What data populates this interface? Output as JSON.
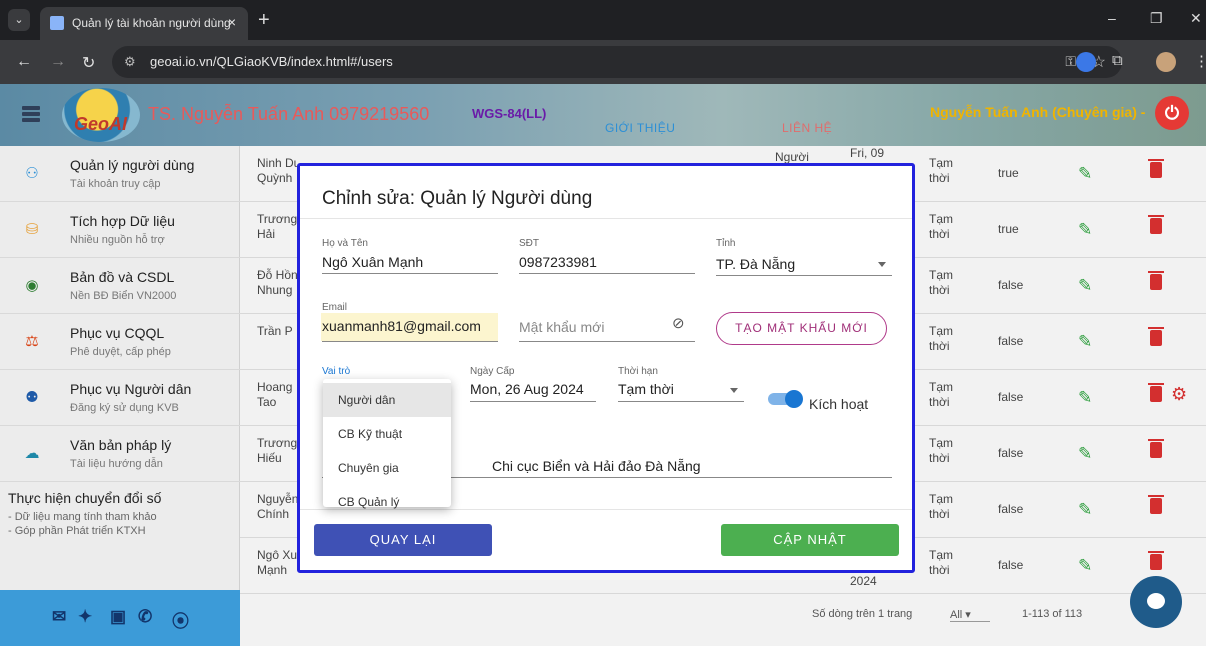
{
  "browser": {
    "tab_title": "Quản lý tài khoản người dùng",
    "tab_close": "×",
    "new_tab": "+",
    "url": "geoai.io.vn/QLGiaoKVB/index.html#/users"
  },
  "header": {
    "logo_text": "GeoAI",
    "brand": "TS. Nguyễn Tuấn Anh 0979219560",
    "crs": "WGS-84(LL)",
    "nav_intro": "GIỚI THIỆU",
    "nav_contact": "LIÊN HỆ",
    "user": "Nguyễn Tuấn Anh (Chuyên gia) -"
  },
  "sidebar": {
    "items": [
      {
        "title": "Quản lý người dùng",
        "sub": "Tài khoản truy cập"
      },
      {
        "title": "Tích hợp Dữ liệu",
        "sub": "Nhiều nguồn hỗ trợ"
      },
      {
        "title": "Bản đồ và CSDL",
        "sub": "Nền BĐ Biển VN2000"
      },
      {
        "title": "Phục vụ CQQL",
        "sub": "Phê duyệt, cấp phép"
      },
      {
        "title": "Phục vụ Người dân",
        "sub": "Đăng ký sử dụng KVB"
      },
      {
        "title": "Văn bản pháp lý",
        "sub": "Tài liệu hướng dẫn"
      }
    ],
    "footer_title": "Thực hiện chuyển đổi số",
    "footer_line1": "- Dữ liệu mang tính tham khảo",
    "footer_line2": "- Góp phần Phát triển KTXH"
  },
  "table": {
    "rows": [
      {
        "name1": "Ninh Duy",
        "name2": "Quỳnh",
        "cat1": "Tạm",
        "cat2": "thời",
        "active": "true"
      },
      {
        "name1": "Trương",
        "name2": "Hải",
        "cat1": "Tạm",
        "cat2": "thời",
        "active": "true"
      },
      {
        "name1": "Đỗ Hồn",
        "name2": "Nhung",
        "cat1": "Tạm",
        "cat2": "thời",
        "active": "false"
      },
      {
        "name1": "Trần P",
        "name2": "",
        "cat1": "Tạm",
        "cat2": "thời",
        "active": "false"
      },
      {
        "name1": "Hoang",
        "name2": "Tao",
        "cat1": "Tạm",
        "cat2": "thời",
        "active": "false"
      },
      {
        "name1": "Trương",
        "name2": "Hiếu",
        "cat1": "Tạm",
        "cat2": "thời",
        "active": "false"
      },
      {
        "name1": "Nguyễn",
        "name2": "Chính",
        "cat1": "Tạm",
        "cat2": "thời",
        "active": "false"
      },
      {
        "name1": "Ngô Xu",
        "name2": "Mạnh",
        "cat1": "Tạm",
        "cat2": "thời",
        "active": "false"
      }
    ],
    "peek_role": "Người",
    "peek_date_top": "Fri, 09",
    "peek_year": "2024",
    "rows_per_page_label": "Số dòng trên 1 trang",
    "rows_per_page_value": "All",
    "range": "1-113 of 113"
  },
  "dialog": {
    "title": "Chỉnh sửa: Quản lý Người dùng",
    "fullname_label": "Họ và Tên",
    "fullname": "Ngô Xuân Mạnh",
    "phone_label": "SĐT",
    "phone": "0987233981",
    "province_label": "Tỉnh",
    "province": "TP. Đà Nẵng",
    "email_label": "Email",
    "email": "xuanmanh81@gmail.com",
    "password_placeholder": "Mật khẩu mới",
    "gen_password": "TẠO MẬT KHẨU MỚI",
    "role_label": "Vai trò",
    "date_label": "Ngày Cấp",
    "date": "Mon, 26 Aug 2024",
    "term_label": "Thời hạn",
    "term": "Tạm thời",
    "active_label": "Kích hoạt",
    "active_on": true,
    "org": "Chi cục Biển và Hải đảo Đà Nẵng",
    "back": "QUAY LẠI",
    "update": "CẬP NHẬT",
    "role_options": [
      "Người dân",
      "CB Kỹ thuật",
      "Chuyên gia",
      "CB Quản lý"
    ]
  },
  "colors": {
    "dialog_border": "#2222dd",
    "back_button": "#3f51b5",
    "update_button": "#4caf50",
    "delete_icon": "#d32f2f",
    "edit_icon": "#2e9e3e"
  }
}
